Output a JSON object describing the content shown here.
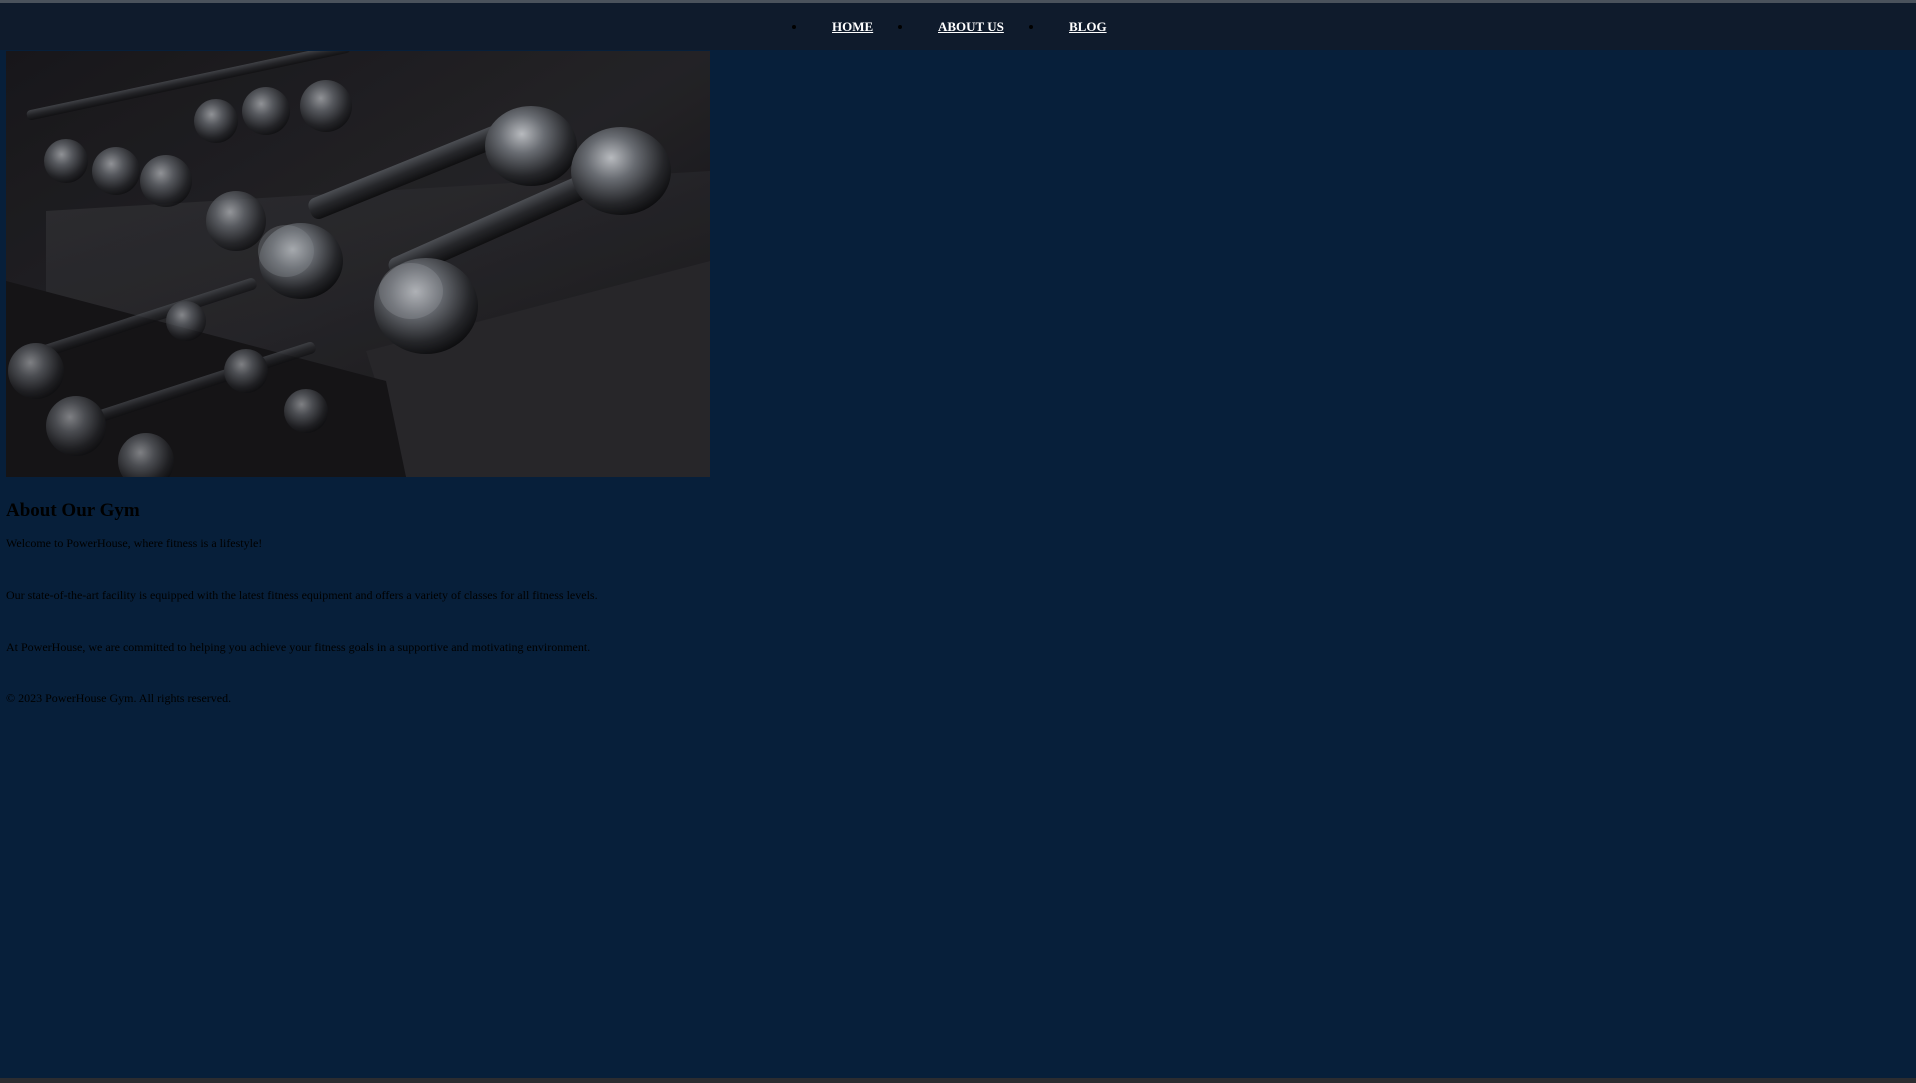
{
  "nav": {
    "items": [
      {
        "label": "HOME"
      },
      {
        "label": "ABOUT US"
      },
      {
        "label": "BLOG"
      }
    ]
  },
  "hero": {
    "icon": "dumbbell-rack-photo"
  },
  "about": {
    "title": "About Our Gym",
    "paragraphs": [
      "Welcome to PowerHouse, where fitness is a lifestyle!",
      "Our state-of-the-art facility is equipped with the latest fitness equipment and offers a variety of classes for all fitness levels.",
      "At PowerHouse, we are committed to helping you achieve your fitness goals in a supportive and motivating environment."
    ]
  },
  "footer": {
    "copyright": "© 2023 PowerHouse Gym. All rights reserved."
  },
  "colors": {
    "background": "#071f3a",
    "navbar": "#0f1b2c",
    "nav_link": "#ffffff",
    "text": "#000000"
  }
}
